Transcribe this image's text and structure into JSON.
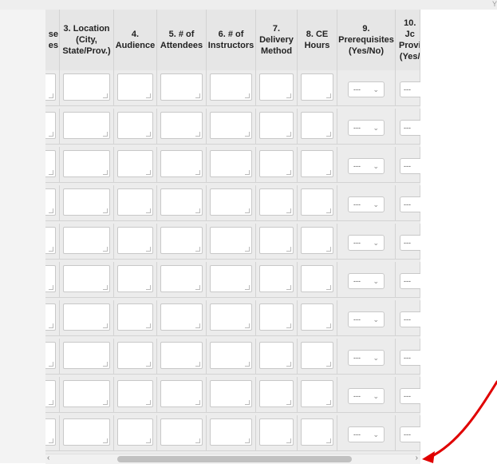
{
  "top_right_text": "Y",
  "columns": [
    {
      "label": "se\nes"
    },
    {
      "label": "3. Location\n(City,\nState/Prov.)"
    },
    {
      "label": "4.\nAudience"
    },
    {
      "label": "5. # of\nAttendees"
    },
    {
      "label": "6. # of\nInstructors"
    },
    {
      "label": "7.\nDelivery\nMethod"
    },
    {
      "label": "8. CE\nHours"
    },
    {
      "label": "9.\nPrerequisites\n(Yes/No)"
    },
    {
      "label": "10. Jc\nProvi\n(Yes/"
    }
  ],
  "dropdown_value": "---",
  "dropdown_chevron": "⌄",
  "row_count": 10,
  "scroll_left_arrow": "‹",
  "scroll_right_arrow": "›",
  "colors": {
    "annotation_arrow": "#e00000"
  },
  "icons": {
    "dropdown": "chevron-down-icon",
    "scroll_left": "scroll-left-icon",
    "scroll_right": "scroll-right-icon"
  }
}
